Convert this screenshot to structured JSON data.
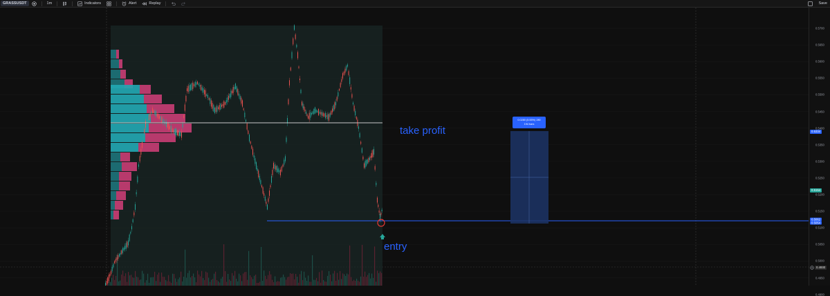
{
  "toolbar": {
    "symbol": "GRASSUSDT",
    "interval": "1m",
    "indicators_label": "Indicators",
    "alert_label": "Alert",
    "replay_label": "Replay",
    "save_label": "Save"
  },
  "price_axis": {
    "ticks": [
      "0.5700",
      "0.5650",
      "0.5600",
      "0.5550",
      "0.5500",
      "0.5450",
      "0.5400",
      "0.5350",
      "0.5300",
      "0.5250",
      "0.5200",
      "0.5150",
      "0.5100",
      "0.5050",
      "0.5000",
      "0.4950",
      "0.4900"
    ],
    "labels": {
      "target": "0.5334",
      "current": "0.5154",
      "entry_top": "0.5062",
      "entry_bottom": "0.5054",
      "low": "0.4930"
    }
  },
  "position_tool": {
    "line1": "0.0280 (5.55%) 280",
    "line2": "194 bars"
  },
  "annotations": {
    "take_profit": "take profit",
    "entry": "entry"
  },
  "colors": {
    "background": "#0f0f0f",
    "accent_blue": "#2962ff",
    "up_teal": "#26a69a",
    "down_red": "#ef5350",
    "volume_profile_teal": "#22a9b4",
    "volume_profile_pink": "#d4407a"
  }
}
